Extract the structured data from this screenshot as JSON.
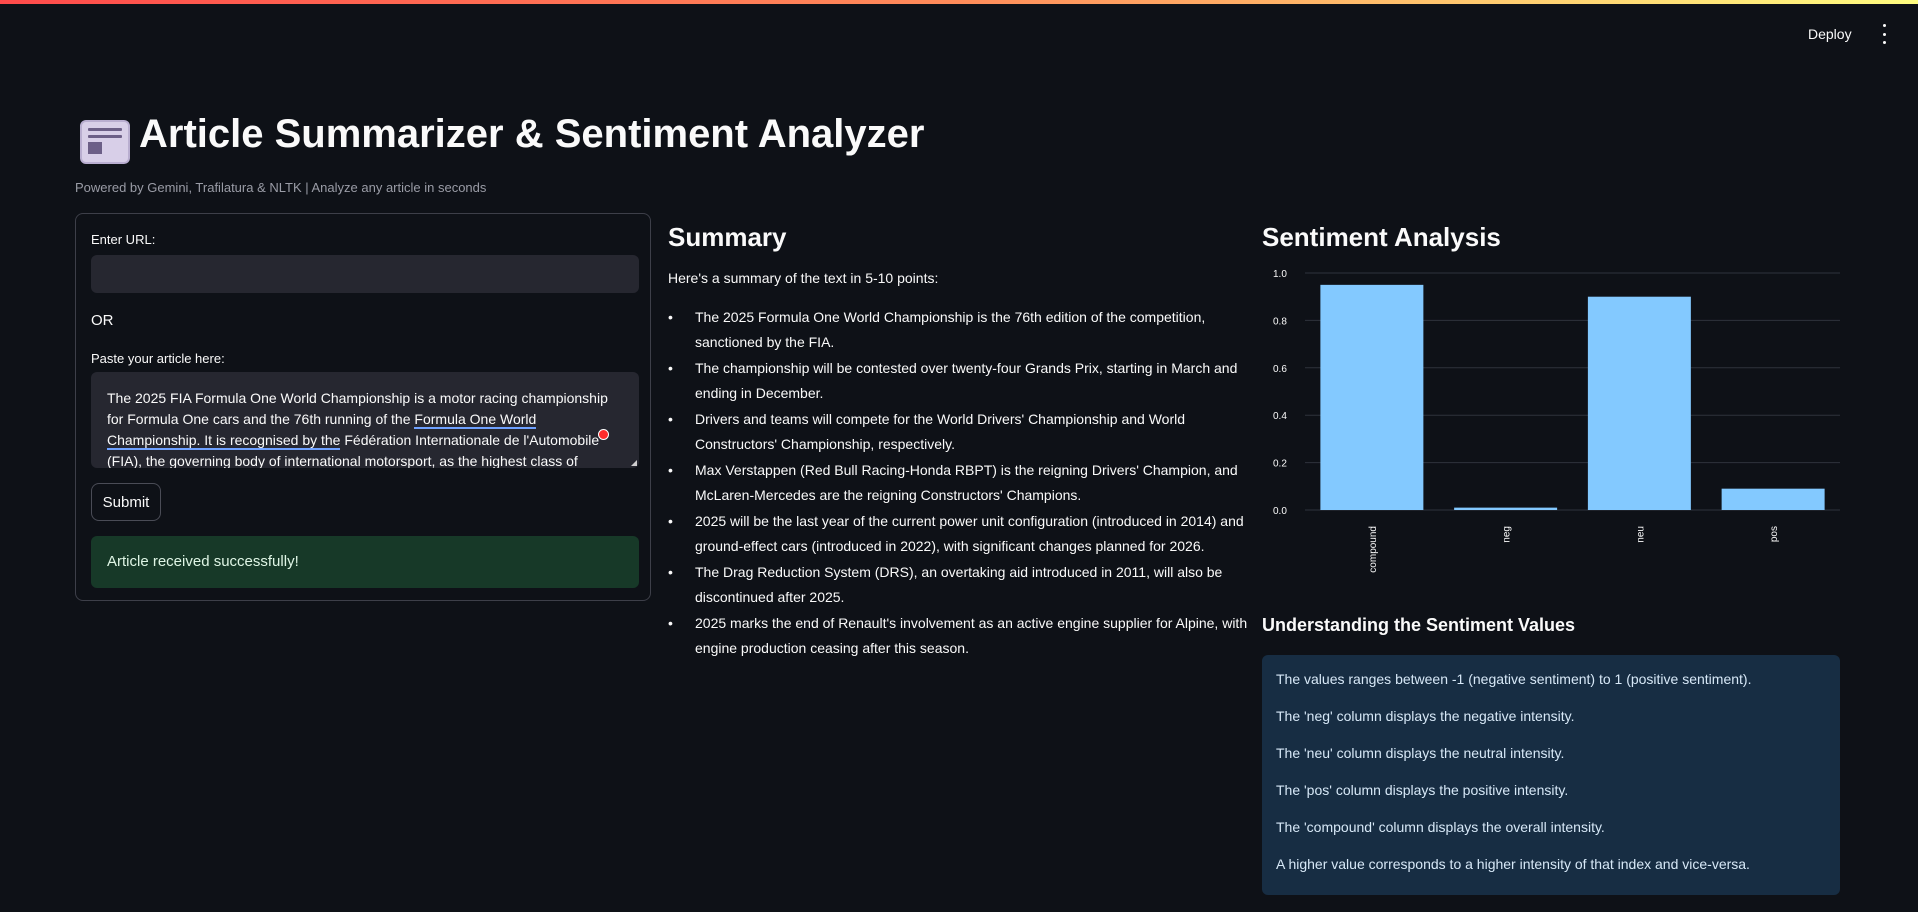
{
  "toolbar": {
    "deploy_label": "Deploy"
  },
  "header": {
    "title": "Article Summarizer & Sentiment Analyzer",
    "subtitle": "Powered by Gemini, Trafilatura & NLTK | Analyze any article in seconds"
  },
  "form": {
    "url_label": "Enter URL:",
    "url_value": "",
    "or_label": "OR",
    "article_label": "Paste your article here:",
    "article_text_1": "The 2025 FIA Formula One World Championship is a motor racing championship for Formula One cars and the 76th running of the ",
    "article_text_link": "Formula One World Championship. It is recognised by the",
    "article_text_2": " Fédération Internationale de l'Automobile (FIA), the governing body of international motorsport, as the highest class of",
    "submit_label": "Submit",
    "success_message": "Article received successfully!"
  },
  "summary": {
    "heading": "Summary",
    "intro": "Here's a summary of the text in 5-10 points:",
    "points": [
      "The 2025 Formula One World Championship is the 76th edition of the competition, sanctioned by the FIA.",
      "The championship will be contested over twenty-four Grands Prix, starting in March and ending in December.",
      "Drivers and teams will compete for the World Drivers' Championship and World Constructors' Championship, respectively.",
      "Max Verstappen (Red Bull Racing-Honda RBPT) is the reigning Drivers' Champion, and McLaren-Mercedes are the reigning Constructors' Champions.",
      "2025 will be the last year of the current power unit configuration (introduced in 2014) and ground-effect cars (introduced in 2022), with significant changes planned for 2026.",
      "The Drag Reduction System (DRS), an overtaking aid introduced in 2011, will also be discontinued after 2025.",
      "2025 marks the end of Renault's involvement as an active engine supplier for Alpine, with engine production ceasing after this season."
    ]
  },
  "sentiment": {
    "heading": "Sentiment Analysis",
    "understanding_heading": "Understanding the Sentiment Values",
    "explanations": [
      "The values ranges between -1 (negative sentiment) to 1 (positive sentiment).",
      "The 'neg' column displays the negative intensity.",
      "The 'neu' column displays the neutral intensity.",
      "The 'pos' column displays the positive intensity.",
      "The 'compound' column displays the overall intensity.",
      "A higher value corresponds to a higher intensity of that index and vice-versa."
    ]
  },
  "chart_data": {
    "type": "bar",
    "categories": [
      "compound",
      "neg",
      "neu",
      "pos"
    ],
    "values": [
      0.95,
      0.01,
      0.9,
      0.09
    ],
    "ylim": [
      0,
      1.0
    ],
    "yticks": [
      "0.0",
      "0.2",
      "0.4",
      "0.6",
      "0.8",
      "1.0"
    ],
    "grid": true,
    "bar_color": "#83c9ff",
    "title": "",
    "xlabel": "",
    "ylabel": ""
  },
  "colors": {
    "background": "#0e1117",
    "success_bg": "#173928",
    "info_bg": "#172d43",
    "bar": "#83c9ff"
  }
}
